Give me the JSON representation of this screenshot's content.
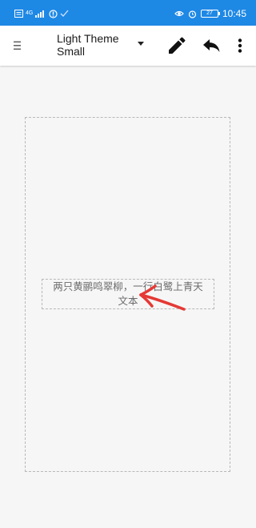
{
  "status_bar": {
    "time": "10:45",
    "battery": "27",
    "network": "4G",
    "background_color": "#1e88e5"
  },
  "toolbar": {
    "menu_icon": "hamburger-menu-icon",
    "title_line1": "Light Theme",
    "title_line2": "Small",
    "edit_icon": "pencil-icon",
    "undo_icon": "undo-arrow-icon",
    "more_icon": "more-vertical-icon"
  },
  "canvas": {
    "text_line1": "两只黄鹂鸣翠柳，一行白鹭上青天",
    "text_line2": "文本",
    "text_color": "#6a6a6a",
    "annotation_color": "#e53935"
  }
}
